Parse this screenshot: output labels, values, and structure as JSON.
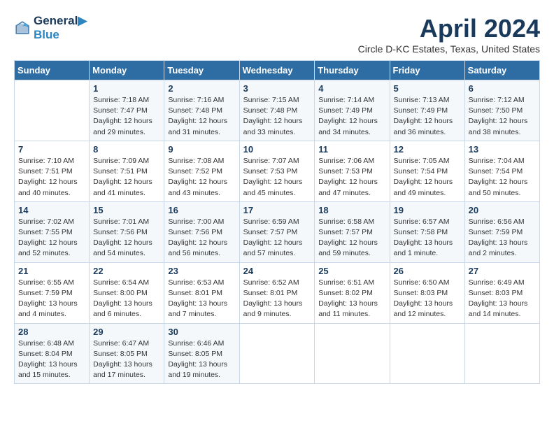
{
  "header": {
    "logo_line1": "General",
    "logo_line2": "Blue",
    "month_title": "April 2024",
    "subtitle": "Circle D-KC Estates, Texas, United States"
  },
  "weekdays": [
    "Sunday",
    "Monday",
    "Tuesday",
    "Wednesday",
    "Thursday",
    "Friday",
    "Saturday"
  ],
  "weeks": [
    [
      {
        "day": "",
        "info": ""
      },
      {
        "day": "1",
        "info": "Sunrise: 7:18 AM\nSunset: 7:47 PM\nDaylight: 12 hours\nand 29 minutes."
      },
      {
        "day": "2",
        "info": "Sunrise: 7:16 AM\nSunset: 7:48 PM\nDaylight: 12 hours\nand 31 minutes."
      },
      {
        "day": "3",
        "info": "Sunrise: 7:15 AM\nSunset: 7:48 PM\nDaylight: 12 hours\nand 33 minutes."
      },
      {
        "day": "4",
        "info": "Sunrise: 7:14 AM\nSunset: 7:49 PM\nDaylight: 12 hours\nand 34 minutes."
      },
      {
        "day": "5",
        "info": "Sunrise: 7:13 AM\nSunset: 7:49 PM\nDaylight: 12 hours\nand 36 minutes."
      },
      {
        "day": "6",
        "info": "Sunrise: 7:12 AM\nSunset: 7:50 PM\nDaylight: 12 hours\nand 38 minutes."
      }
    ],
    [
      {
        "day": "7",
        "info": "Sunrise: 7:10 AM\nSunset: 7:51 PM\nDaylight: 12 hours\nand 40 minutes."
      },
      {
        "day": "8",
        "info": "Sunrise: 7:09 AM\nSunset: 7:51 PM\nDaylight: 12 hours\nand 41 minutes."
      },
      {
        "day": "9",
        "info": "Sunrise: 7:08 AM\nSunset: 7:52 PM\nDaylight: 12 hours\nand 43 minutes."
      },
      {
        "day": "10",
        "info": "Sunrise: 7:07 AM\nSunset: 7:53 PM\nDaylight: 12 hours\nand 45 minutes."
      },
      {
        "day": "11",
        "info": "Sunrise: 7:06 AM\nSunset: 7:53 PM\nDaylight: 12 hours\nand 47 minutes."
      },
      {
        "day": "12",
        "info": "Sunrise: 7:05 AM\nSunset: 7:54 PM\nDaylight: 12 hours\nand 49 minutes."
      },
      {
        "day": "13",
        "info": "Sunrise: 7:04 AM\nSunset: 7:54 PM\nDaylight: 12 hours\nand 50 minutes."
      }
    ],
    [
      {
        "day": "14",
        "info": "Sunrise: 7:02 AM\nSunset: 7:55 PM\nDaylight: 12 hours\nand 52 minutes."
      },
      {
        "day": "15",
        "info": "Sunrise: 7:01 AM\nSunset: 7:56 PM\nDaylight: 12 hours\nand 54 minutes."
      },
      {
        "day": "16",
        "info": "Sunrise: 7:00 AM\nSunset: 7:56 PM\nDaylight: 12 hours\nand 56 minutes."
      },
      {
        "day": "17",
        "info": "Sunrise: 6:59 AM\nSunset: 7:57 PM\nDaylight: 12 hours\nand 57 minutes."
      },
      {
        "day": "18",
        "info": "Sunrise: 6:58 AM\nSunset: 7:57 PM\nDaylight: 12 hours\nand 59 minutes."
      },
      {
        "day": "19",
        "info": "Sunrise: 6:57 AM\nSunset: 7:58 PM\nDaylight: 13 hours\nand 1 minute."
      },
      {
        "day": "20",
        "info": "Sunrise: 6:56 AM\nSunset: 7:59 PM\nDaylight: 13 hours\nand 2 minutes."
      }
    ],
    [
      {
        "day": "21",
        "info": "Sunrise: 6:55 AM\nSunset: 7:59 PM\nDaylight: 13 hours\nand 4 minutes."
      },
      {
        "day": "22",
        "info": "Sunrise: 6:54 AM\nSunset: 8:00 PM\nDaylight: 13 hours\nand 6 minutes."
      },
      {
        "day": "23",
        "info": "Sunrise: 6:53 AM\nSunset: 8:01 PM\nDaylight: 13 hours\nand 7 minutes."
      },
      {
        "day": "24",
        "info": "Sunrise: 6:52 AM\nSunset: 8:01 PM\nDaylight: 13 hours\nand 9 minutes."
      },
      {
        "day": "25",
        "info": "Sunrise: 6:51 AM\nSunset: 8:02 PM\nDaylight: 13 hours\nand 11 minutes."
      },
      {
        "day": "26",
        "info": "Sunrise: 6:50 AM\nSunset: 8:03 PM\nDaylight: 13 hours\nand 12 minutes."
      },
      {
        "day": "27",
        "info": "Sunrise: 6:49 AM\nSunset: 8:03 PM\nDaylight: 13 hours\nand 14 minutes."
      }
    ],
    [
      {
        "day": "28",
        "info": "Sunrise: 6:48 AM\nSunset: 8:04 PM\nDaylight: 13 hours\nand 15 minutes."
      },
      {
        "day": "29",
        "info": "Sunrise: 6:47 AM\nSunset: 8:05 PM\nDaylight: 13 hours\nand 17 minutes."
      },
      {
        "day": "30",
        "info": "Sunrise: 6:46 AM\nSunset: 8:05 PM\nDaylight: 13 hours\nand 19 minutes."
      },
      {
        "day": "",
        "info": ""
      },
      {
        "day": "",
        "info": ""
      },
      {
        "day": "",
        "info": ""
      },
      {
        "day": "",
        "info": ""
      }
    ]
  ]
}
